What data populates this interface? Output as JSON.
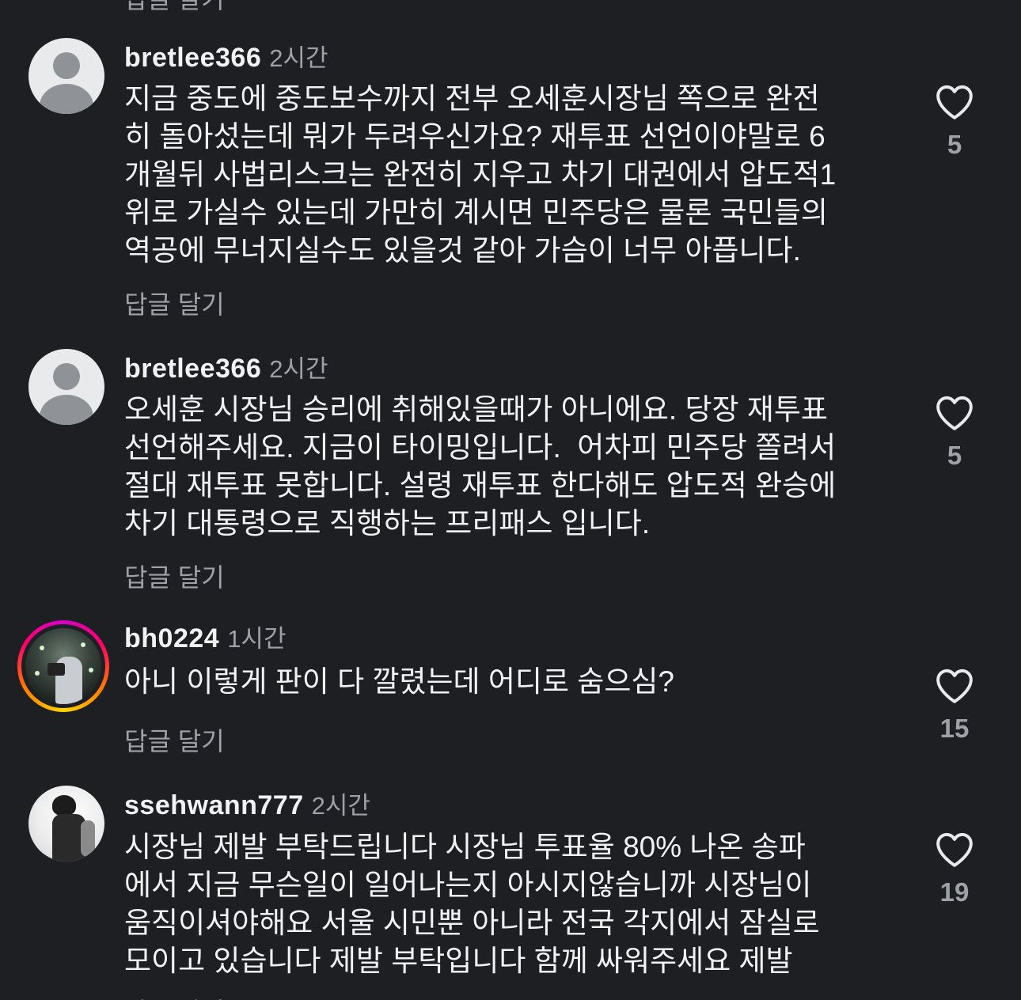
{
  "cutoff_top_label": "답글 달기",
  "cutoff_bottom_label": "답글 달기",
  "comments": [
    {
      "username": "bretlee366",
      "time": "2시간",
      "text": "지금 중도에 중도보수까지 전부 오세훈시장님 쪽으로 완전\n히 돌아섰는데 뭐가 두려우신가요? 재투표 선언이야말로 6\n개월뒤 사법리스크는 완전히 지우고 차기 대권에서 압도적1\n위로 가실수 있는데 가만히 계시면 민주당은 물론 국민들의\n역공에 무너지실수도 있을것 같아 가슴이 너무 아픕니다.",
      "reply_label": "답글 달기",
      "likes": "5",
      "avatar": "default-avatar"
    },
    {
      "username": "bretlee366",
      "time": "2시간",
      "text": "오세훈 시장님 승리에 취해있을때가 아니에요. 당장 재투표\n선언해주세요. 지금이 타이밍입니다.  어차피 민주당 쫄려서\n절대 재투표 못합니다. 설령 재투표 한다해도 압도적 완승에\n차기 대통령으로 직행하는 프리패스 입니다.",
      "reply_label": "답글 달기",
      "likes": "5",
      "avatar": "default-avatar"
    },
    {
      "username": "bh0224",
      "time": "1시간",
      "text": "아니 이렇게 판이 다 깔렸는데 어디로 숨으심?",
      "reply_label": "답글 달기",
      "likes": "15",
      "avatar": "story-photo-avatar"
    },
    {
      "username": "ssehwann777",
      "time": "2시간",
      "text": "시장님 제발 부탁드립니다 시장님 투표율 80% 나온 송파\n에서 지금 무슨일이 일어나는지 아시지않습니까 시장님이\n움직이셔야해요 서울 시민뿐 아니라 전국 각지에서 잠실로\n모이고 있습니다 제발 부탁입니다 함께 싸워주세요 제발",
      "reply_label": "답글 달기",
      "likes": "19",
      "avatar": "bw-photo-avatar"
    }
  ],
  "colors": {
    "background": "#1d1f23",
    "text_primary": "#f1f2f4",
    "text_secondary": "#9ea1a8"
  }
}
